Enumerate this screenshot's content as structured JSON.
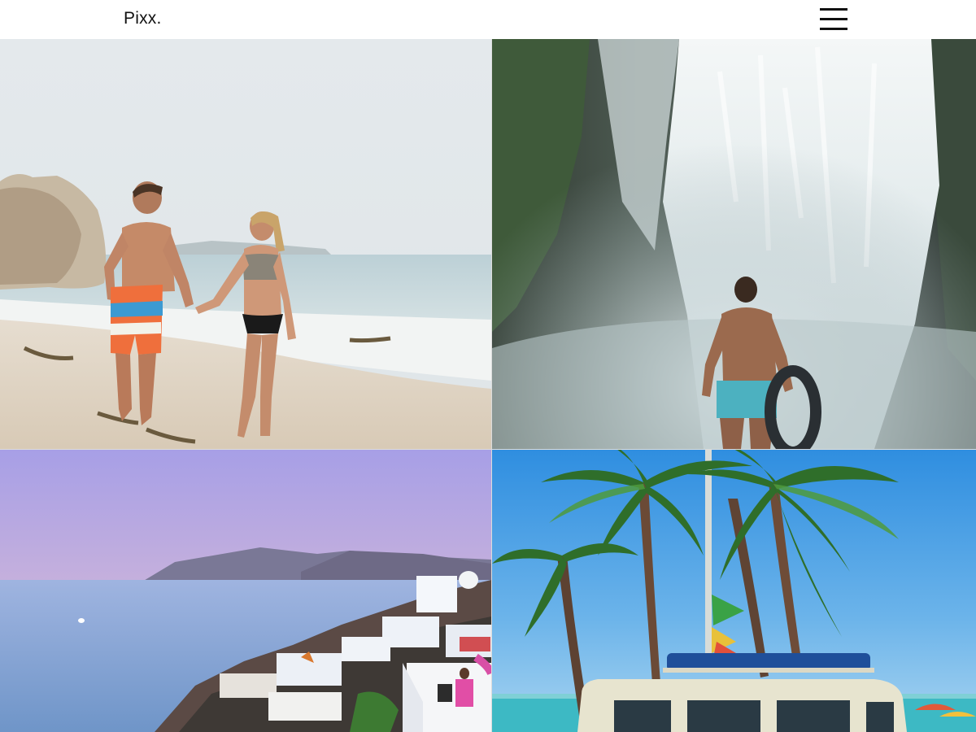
{
  "header": {
    "logo": "Pixx.",
    "menu_icon": "hamburger-menu-icon"
  },
  "gallery": {
    "photos": [
      {
        "subject": "beach-couple"
      },
      {
        "subject": "waterfall-man"
      },
      {
        "subject": "santorini-village"
      },
      {
        "subject": "palm-trees-van"
      }
    ]
  }
}
